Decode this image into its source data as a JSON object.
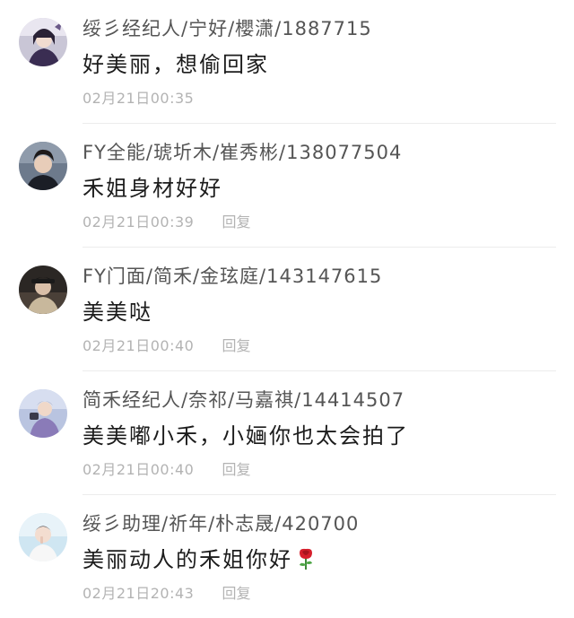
{
  "comments": [
    {
      "username": "绥彡经纪人/宁好/櫻潇/1887715",
      "content": "好美丽，想偷回家",
      "time": "02月21日00:35",
      "reply_label": ""
    },
    {
      "username": "FY全能/琥圻木/崔秀彬/138077504",
      "content": "禾姐身材好好",
      "time": "02月21日00:39",
      "reply_label": "回复"
    },
    {
      "username": "FY门面/简禾/金玹庭/143147615",
      "content": "美美哒",
      "time": "02月21日00:40",
      "reply_label": "回复"
    },
    {
      "username": "简禾经纪人/奈祁/马嘉祺/14414507",
      "content": "美美嘟小禾，小婳你也太会拍了",
      "time": "02月21日00:40",
      "reply_label": "回复"
    },
    {
      "username": "绥彡助理/祈年/朴志晟/420700",
      "content": "美丽动人的禾姐你好",
      "time": "02月21日20:43",
      "reply_label": "回复",
      "emoji": "rose-icon"
    }
  ],
  "colors": {
    "username": "#555555",
    "content": "#1c1c1c",
    "meta": "#b3b3b3",
    "divider": "#ececec",
    "rose": "#d61f2c"
  }
}
